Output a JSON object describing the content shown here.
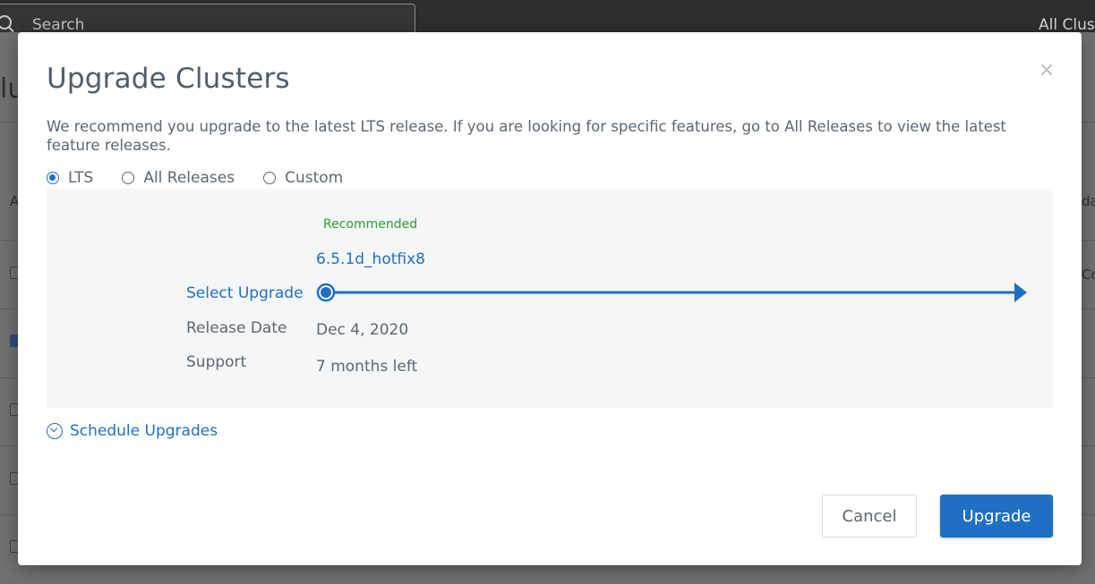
{
  "background": {
    "search_placeholder": "Search",
    "top_right_label": "All Clus",
    "page_title_fragment": "lu",
    "right_col_fragments": [
      "da",
      "Co"
    ],
    "left_col_fragment": "A"
  },
  "modal": {
    "title": "Upgrade Clusters",
    "description": "We recommend you upgrade to the latest LTS release. If you are looking for specific features, go to All Releases to view the latest feature releases.",
    "close_symbol": "×",
    "release_options": [
      {
        "label": "LTS",
        "selected": true
      },
      {
        "label": "All Releases",
        "selected": false
      },
      {
        "label": "Custom",
        "selected": false
      }
    ],
    "upgrade_panel": {
      "recommended_label": "Recommended",
      "version": "6.5.1d_hotfix8",
      "select_upgrade_label": "Select Upgrade",
      "release_date_label": "Release Date",
      "release_date_value": "Dec 4, 2020",
      "support_label": "Support",
      "support_value": "7 months left"
    },
    "schedule_label": "Schedule Upgrades",
    "buttons": {
      "cancel": "Cancel",
      "upgrade": "Upgrade"
    }
  },
  "colors": {
    "accent": "#1f6fc4",
    "recommended": "#2e9e2e",
    "text": "#5b6773",
    "title": "#4d5d6c",
    "panel_bg": "#f4f6f8"
  },
  "icons": {
    "close": "close-icon",
    "schedule": "chevron-down-circle-icon",
    "search": "search-icon"
  }
}
